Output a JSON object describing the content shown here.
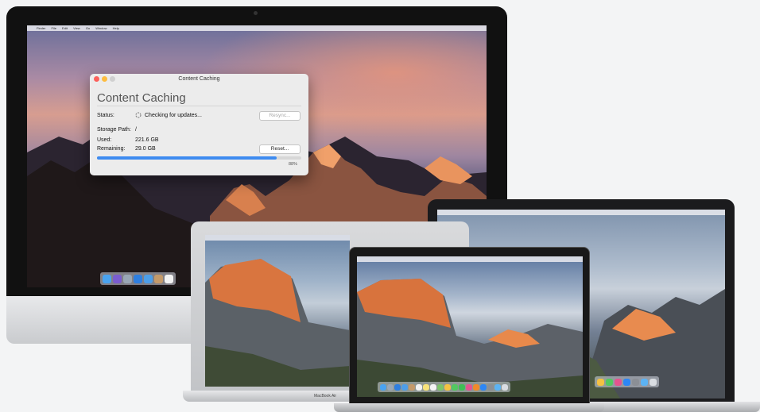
{
  "menubar": {
    "items": [
      "Finder",
      "File",
      "Edit",
      "View",
      "Go",
      "Window",
      "Help"
    ]
  },
  "window": {
    "title": "Content Caching",
    "heading": "Content Caching",
    "status_label": "Status:",
    "status_value": "Checking for updates...",
    "resync_button": "Resync...",
    "storage_path_label": "Storage Path:",
    "storage_path_value": "/",
    "used_label": "Used:",
    "used_value": "221.6 GB",
    "remaining_label": "Remaining:",
    "remaining_value": "29.0 GB",
    "reset_button": "Reset...",
    "progress_percent": 88,
    "progress_text": "88%"
  },
  "macbook_air": {
    "label": "MacBook Air"
  },
  "colors": {
    "accent": "#3e8bf0",
    "close": "#fc605b",
    "minimize": "#fdbc40",
    "zoom": "#d0d0d0"
  }
}
